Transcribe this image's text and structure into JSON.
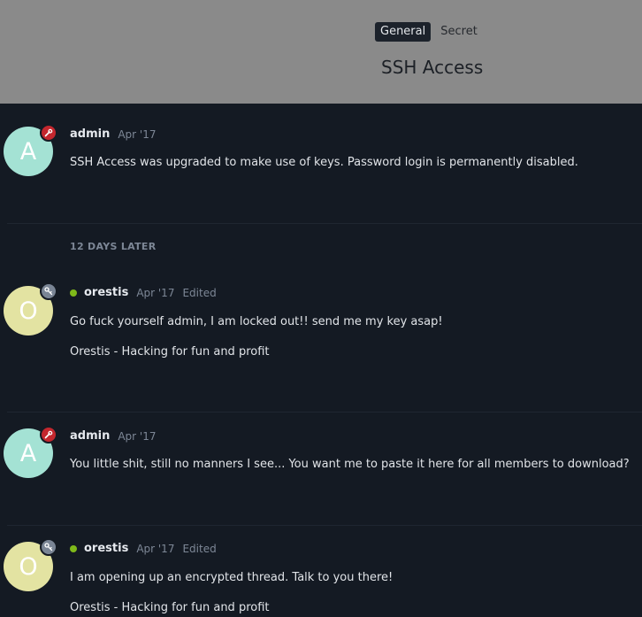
{
  "header": {
    "tabs": [
      {
        "label": "General"
      },
      {
        "label": "Secret"
      }
    ],
    "title": "SSH Access"
  },
  "time_gap": "12 DAYS LATER",
  "posts": [
    {
      "avatar_letter": "A",
      "badge_icon": "wrench-icon",
      "username": "admin",
      "date": "Apr '17",
      "online": false,
      "edited": "",
      "lines": [
        "SSH Access was upgraded to make use of keys. Password login is permanently disabled."
      ]
    },
    {
      "avatar_letter": "O",
      "badge_icon": "key-icon",
      "username": "orestis",
      "date": "Apr '17",
      "online": true,
      "edited": "Edited",
      "lines": [
        "Go fuck yourself admin, I am locked out!! send me my key asap!",
        "Orestis - Hacking for fun and profit"
      ]
    },
    {
      "avatar_letter": "A",
      "badge_icon": "wrench-icon",
      "username": "admin",
      "date": "Apr '17",
      "online": false,
      "edited": "",
      "lines": [
        "You little shit, still no manners I see... You want me to paste it here for all members to download?"
      ]
    },
    {
      "avatar_letter": "O",
      "badge_icon": "key-icon",
      "username": "orestis",
      "date": "Apr '17",
      "online": true,
      "edited": "Edited",
      "lines": [
        "I am opening up an encrypted thread. Talk to you there!",
        "Orestis - Hacking for fun and profit"
      ]
    }
  ],
  "colors": {
    "header_bg": "#8a8a8a",
    "page_bg": "#141a23",
    "admin_badge": "#c4272e",
    "online": "#7fb91a"
  }
}
